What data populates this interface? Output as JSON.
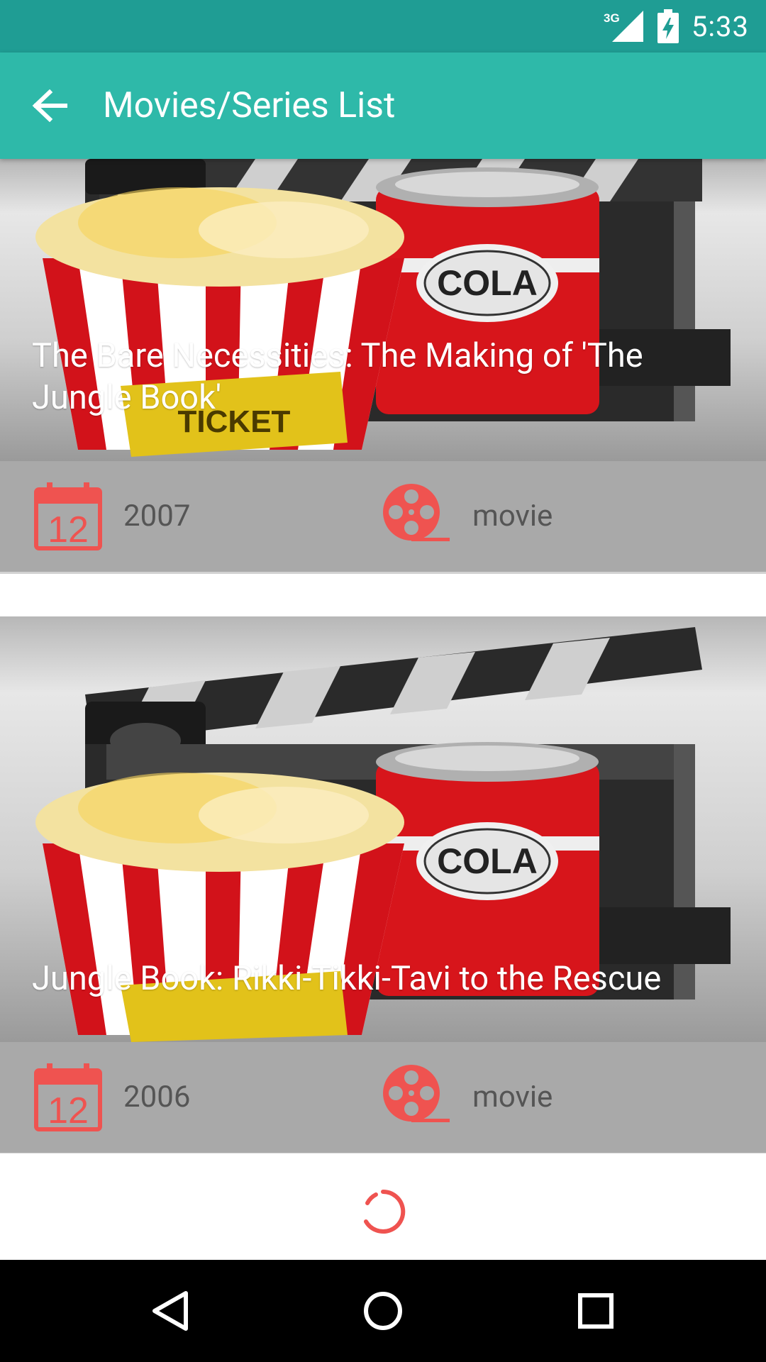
{
  "status_bar": {
    "network": "3G",
    "time": "5:33",
    "icons": [
      "signal-icon",
      "battery-charging-icon"
    ]
  },
  "app_bar": {
    "title": "Movies/Series List",
    "back_icon": "arrow-back-icon"
  },
  "items": [
    {
      "title": "The Bare Necessities: The Making of 'The Jungle Book'",
      "year": "2007",
      "type": "movie"
    },
    {
      "title": "Jungle Book: Rikki-Tikki-Tavi to the Rescue",
      "year": "2006",
      "type": "movie"
    }
  ],
  "icons": {
    "calendar": "calendar-icon",
    "film": "film-reel-icon",
    "placeholder_art": "popcorn-cola-clapperboard-image"
  },
  "colors": {
    "status_bar": "#1f9d94",
    "app_bar": "#2eb9a9",
    "accent": "#ef5350",
    "meta_background": "#a9a9a9",
    "navigation_bar": "#000000"
  },
  "nav": [
    "back-icon",
    "home-icon",
    "recents-icon"
  ]
}
